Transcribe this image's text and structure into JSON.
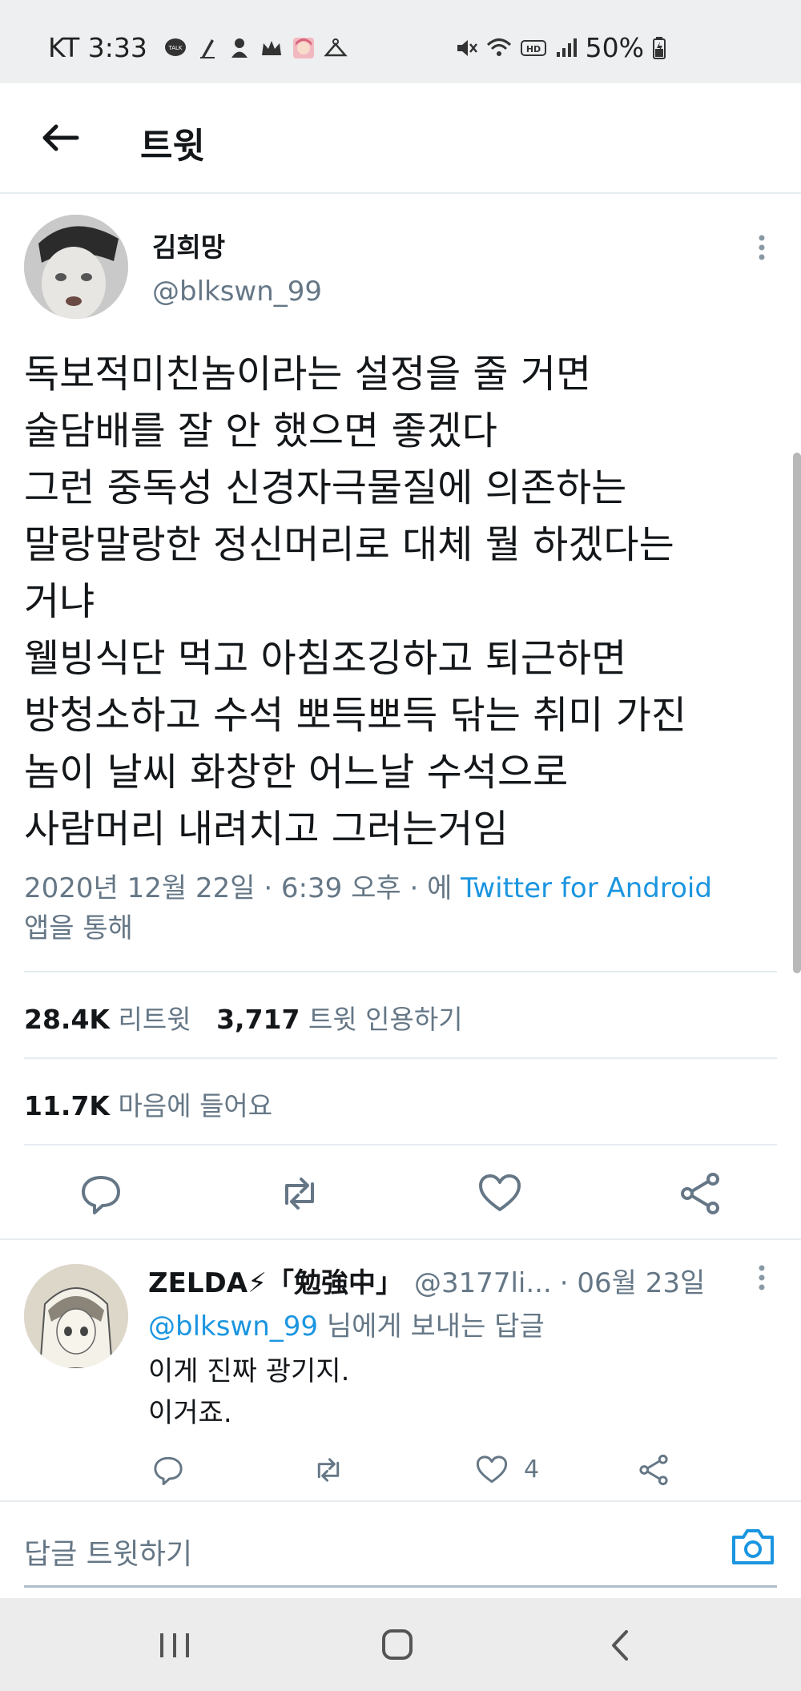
{
  "status_bar": {
    "carrier_time": "KT 3:33",
    "battery": "50%",
    "icons": [
      "talk-icon",
      "pen-icon",
      "character-icon",
      "crown-icon",
      "anime-avatar-icon",
      "hanger-icon",
      "mute-icon",
      "wifi-icon",
      "hd-icon",
      "signal-icon",
      "battery-icon"
    ]
  },
  "header": {
    "title": "트윗",
    "back_icon": "arrow-left-icon"
  },
  "tweet": {
    "author_name": "김희망",
    "author_handle": "@blkswn_99",
    "lines": [
      "독보적미친놈이라는 설정을 줄 거면",
      "술담배를 잘 안 했으면 좋겠다",
      "그런 중독성 신경자극물질에 의존하는",
      "말랑말랑한 정신머리로 대체 뭘 하겠다는",
      "거냐",
      "웰빙식단 먹고 아침조깅하고 퇴근하면",
      "방청소하고 수석 뽀득뽀득 닦는 취미 가진",
      "놈이 날씨 화창한 어느날 수석으로",
      "사람머리 내려치고 그러는거임"
    ],
    "timestamp": "2020년 12월 22일 · 6:39 오후 · 에",
    "source": "Twitter for Android",
    "source_suffix": "앱을 통해",
    "retweets_count": "28.4K",
    "retweets_label": "리트윗",
    "quotes_count": "3,717",
    "quotes_label": "트윗 인용하기",
    "likes_count": "11.7K",
    "likes_label": "마음에 들어요"
  },
  "reply": {
    "name": "ZELDA⚡「勉強中」",
    "handle": "@3177li...",
    "date": "· 06월 23일",
    "reply_to_handle": "@blkswn_99",
    "reply_to_suffix": "님에게 보내는 답글",
    "text_lines": [
      "이게 진짜 광기지.",
      "이거죠."
    ],
    "like_count": "4"
  },
  "compose": {
    "placeholder": "답글 트윗하기"
  },
  "colors": {
    "link": "#1b95e0",
    "muted": "#657786",
    "text": "#14171a",
    "divider": "#e6ecf0"
  }
}
